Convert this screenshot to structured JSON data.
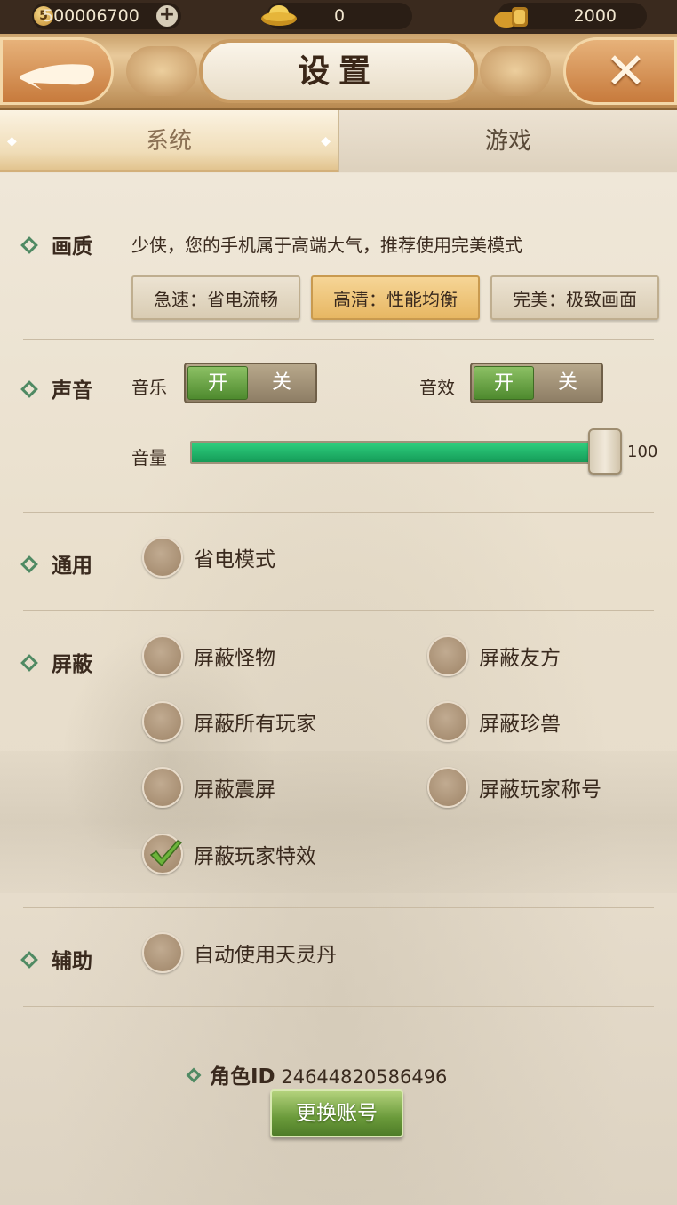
{
  "topbar": {
    "coins": "500006700",
    "coin_icon_digit": "5",
    "ingots": "0",
    "gold": "2000"
  },
  "title": "设置",
  "tabs": [
    {
      "label": "系统",
      "active": true
    },
    {
      "label": "游戏",
      "active": false
    }
  ],
  "quality": {
    "label": "画质",
    "hint": "少侠，您的手机属于高端大气，推荐使用完美模式",
    "options": [
      "急速：省电流畅",
      "高清：性能均衡",
      "完美：极致画面"
    ],
    "selected_index": 1
  },
  "sound": {
    "label": "声音",
    "music_label": "音乐",
    "effect_label": "音效",
    "on": "开",
    "off": "关",
    "volume_label": "音量",
    "volume": 100
  },
  "general": {
    "label": "通用",
    "options": [
      {
        "label": "省电模式",
        "checked": false
      }
    ]
  },
  "block": {
    "label": "屏蔽",
    "options": [
      {
        "label": "屏蔽怪物",
        "checked": false
      },
      {
        "label": "屏蔽友方",
        "checked": false
      },
      {
        "label": "屏蔽所有玩家",
        "checked": false
      },
      {
        "label": "屏蔽珍兽",
        "checked": false
      },
      {
        "label": "屏蔽震屏",
        "checked": false
      },
      {
        "label": "屏蔽玩家称号",
        "checked": false
      },
      {
        "label": "屏蔽玩家特效",
        "checked": true
      }
    ]
  },
  "assist": {
    "label": "辅助",
    "options": [
      {
        "label": "自动使用天灵丹",
        "checked": false
      }
    ]
  },
  "account": {
    "role_id_label": "角色ID",
    "role_id": "24644820586496",
    "switch_label": "更换账号"
  },
  "colors": {
    "accent_green": "#4f8a63",
    "selected_quality": "#e7b763",
    "volume_fill": "#1fb868"
  }
}
